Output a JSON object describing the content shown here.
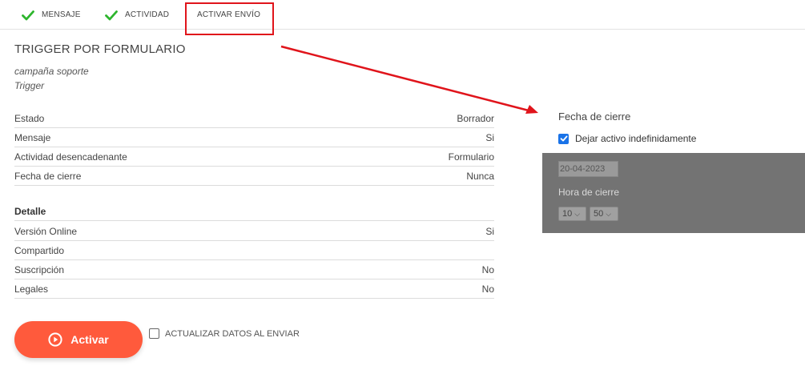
{
  "tabs": [
    {
      "label": "MENSAJE",
      "done": true
    },
    {
      "label": "ACTIVIDAD",
      "done": true
    },
    {
      "label": "ACTIVAR ENVÍO",
      "done": false
    }
  ],
  "colors": {
    "check": "#2db52d",
    "accent_button": "#ff5a3c",
    "annotation": "#e0141b",
    "checkbox_checked": "#1a73e8",
    "panel": "#737373"
  },
  "campaign": {
    "title": "TRIGGER POR FORMULARIO",
    "name": "campaña soporte",
    "type": "Trigger"
  },
  "summary": [
    {
      "label": "Estado",
      "value": "Borrador"
    },
    {
      "label": "Mensaje",
      "value": "Si"
    },
    {
      "label": "Actividad desencadenante",
      "value": "Formulario"
    },
    {
      "label": "Fecha de cierre",
      "value": "Nunca"
    }
  ],
  "detalle": {
    "heading": "Detalle",
    "rows": [
      {
        "label": "Versión Online",
        "value": "Si"
      },
      {
        "label": "Compartido",
        "value": ""
      },
      {
        "label": "Suscripción",
        "value": "No"
      },
      {
        "label": "Legales",
        "value": "No"
      }
    ]
  },
  "actions": {
    "activar_label": "Activar",
    "actualizar_label": "ACTUALIZAR DATOS AL ENVIAR",
    "actualizar_checked": false
  },
  "cierre": {
    "title": "Fecha de cierre",
    "indefinido_label": "Dejar activo indefinidamente",
    "indefinido_checked": true,
    "date_value": "20-04-2023",
    "hora_label": "Hora de cierre",
    "hour": "10",
    "minute": "50"
  },
  "icons": {
    "tab_done": "check-icon",
    "activar": "play-circle-icon",
    "dropdown": "chevron-down-icon"
  }
}
